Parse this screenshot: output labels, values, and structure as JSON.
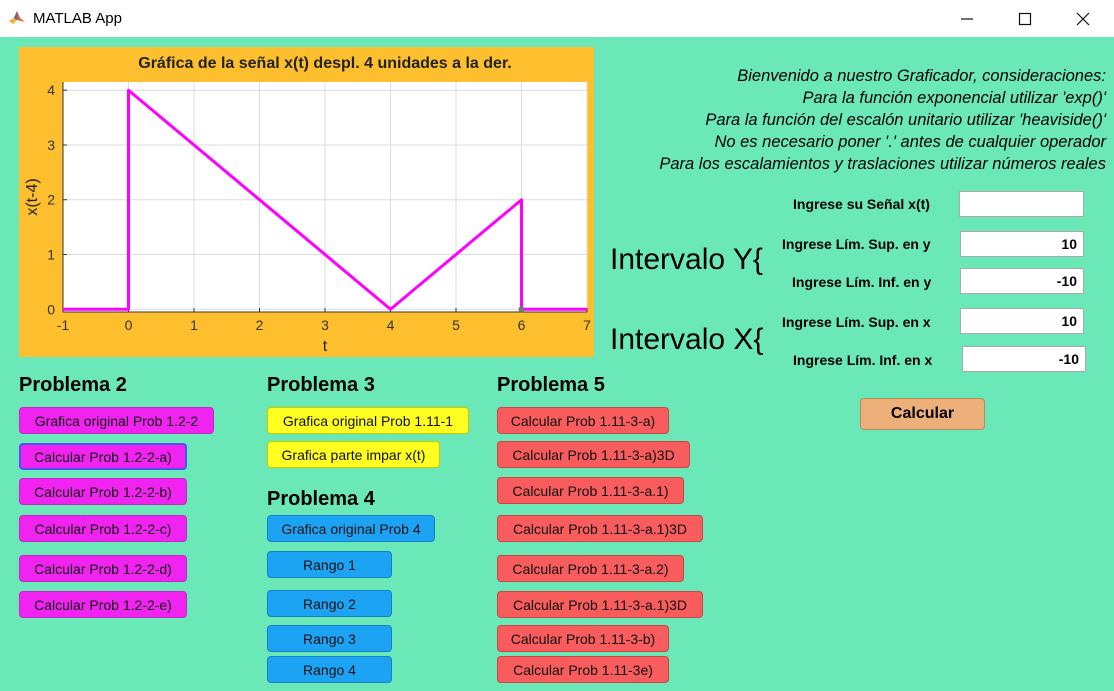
{
  "window": {
    "title": "MATLAB App",
    "minimize": "—",
    "maximize": "☐",
    "close": "✕"
  },
  "welcome": [
    "Bienvenido a nuestro Graficador, consideraciones:",
    "Para la función exponencial utilizar 'exp()'",
    "Para la función del escalón unitario utilizar 'heaviside()'",
    "No es necesario poner '.' antes de cualquier operador",
    "Para los escalamientos y traslaciones utilizar números reales"
  ],
  "inputs": {
    "signal_label": "Ingrese su Señal x(t)",
    "signal_value": "",
    "y_sup_label": "Ingrese Lím. Sup. en y",
    "y_sup_value": "10",
    "y_inf_label": "Ingrese Lím. Inf. en y",
    "y_inf_value": "-10",
    "x_sup_label": "Ingrese Lím. Sup. en x",
    "x_sup_value": "10",
    "x_inf_label": "Ingrese Lím. Inf. en x",
    "x_inf_value": "-10"
  },
  "intervals": {
    "y": "Intervalo Y{",
    "x": "Intervalo X{"
  },
  "calc_label": "Calcular",
  "sections": {
    "p2": "Problema 2",
    "p3": "Problema 3",
    "p4": "Problema 4",
    "p5": "Problema 5"
  },
  "buttons": {
    "p2": [
      "Grafica original Prob 1.2-2",
      "Calcular Prob 1.2-2-a)",
      "Calcular Prob 1.2-2-b)",
      "Calcular Prob 1.2-2-c)",
      "Calcular Prob 1.2-2-d)",
      "Calcular Prob 1.2-2-e)"
    ],
    "p3": [
      "Grafica original Prob 1.11-1",
      "Grafica parte impar x(t)"
    ],
    "p4": [
      "Grafica original Prob 4",
      "Rango 1",
      "Rango 2",
      "Rango 3",
      "Rango 4"
    ],
    "p5": [
      "Calcular Prob 1.11-3-a)",
      "Calcular Prob 1.11-3-a)3D",
      "Calcular Prob 1.11-3-a.1)",
      "Calcular Prob 1.11-3-a.1)3D",
      "Calcular Prob 1.11-3-a.2)",
      "Calcular Prob 1.11-3-a.1)3D",
      "Calcular Prob 1.11-3-b)",
      "Calcular Prob 1.11-3e)"
    ]
  },
  "colors": {
    "background": "#6be8b8",
    "plot_panel": "#fdbf2d",
    "line": "#ff00ff"
  },
  "chart_data": {
    "type": "line",
    "title": "Gráfica de la señal x(t) despl. 4 unidades a la der.",
    "xlabel": "t",
    "ylabel": "x(t-4)",
    "xlim": [
      -1,
      7
    ],
    "ylim": [
      0,
      4
    ],
    "xticks": [
      "-1",
      "0",
      "1",
      "2",
      "3",
      "4",
      "5",
      "6",
      "7"
    ],
    "yticks": [
      "0",
      "1",
      "2",
      "3",
      "4"
    ],
    "grid": true,
    "series": [
      {
        "x": [
          -1,
          0,
          0,
          4,
          6,
          6,
          7
        ],
        "y": [
          0,
          0,
          4,
          0,
          2,
          0,
          0
        ]
      }
    ]
  }
}
